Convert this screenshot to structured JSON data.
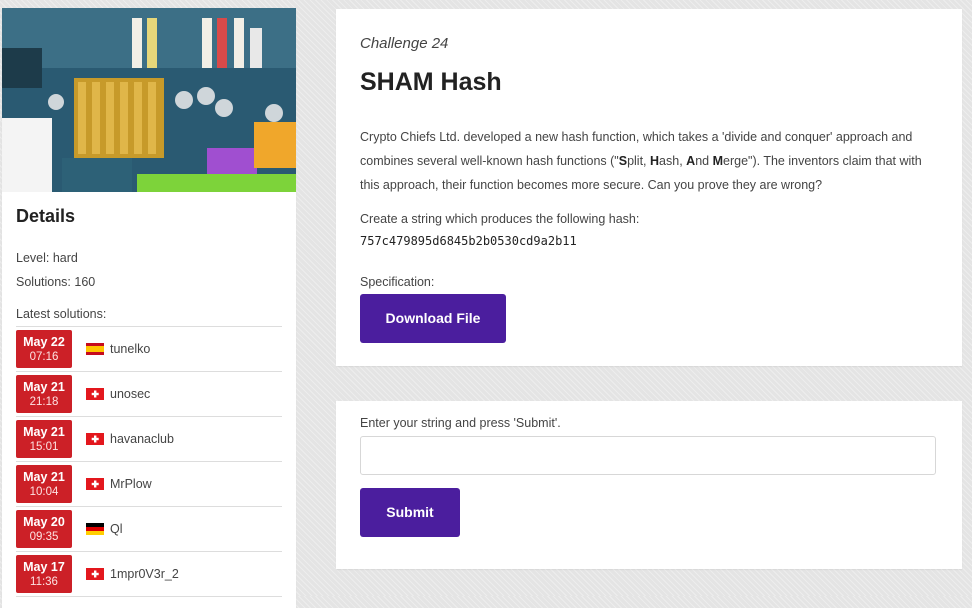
{
  "sidebar": {
    "details_title": "Details",
    "level": "Level: hard",
    "solutions": "Solutions: 160",
    "latest_label": "Latest solutions:",
    "latest": [
      {
        "day": "May 22",
        "time": "07:16",
        "flag": "es",
        "name": "tunelko"
      },
      {
        "day": "May 21",
        "time": "21:18",
        "flag": "ch",
        "name": "unosec"
      },
      {
        "day": "May 21",
        "time": "15:01",
        "flag": "ch",
        "name": "havanaclub"
      },
      {
        "day": "May 21",
        "time": "10:04",
        "flag": "ch",
        "name": "MrPlow"
      },
      {
        "day": "May 20",
        "time": "09:35",
        "flag": "de",
        "name": "Ql"
      },
      {
        "day": "May 17",
        "time": "11:36",
        "flag": "ch",
        "name": "1mpr0V3r_2"
      }
    ]
  },
  "challenge": {
    "subtitle": "Challenge 24",
    "title": "SHAM Hash",
    "desc_before": "Crypto Chiefs Ltd. developed a new hash function, which takes a 'divide and conquer' approach and combines several well-known hash functions (\"",
    "s_bold": "S",
    "s_rest": "plit, ",
    "h_bold": "H",
    "h_rest": "ash, ",
    "a_bold": "A",
    "a_rest": "nd ",
    "m_bold": "M",
    "desc_after": "erge\"). The inventors claim that with this approach, their function becomes more secure. Can you prove they are wrong?",
    "create_label": "Create a string which produces the following hash:",
    "hash": "757c479895d6845b2b0530cd9a2b11",
    "spec_label": "Specification:",
    "download_label": "Download File"
  },
  "submit_form": {
    "prompt": "Enter your string and press 'Submit'.",
    "input_value": "",
    "submit_label": "Submit"
  },
  "colors": {
    "badge_red": "#cc2027",
    "button_purple": "#4b1e9e"
  }
}
